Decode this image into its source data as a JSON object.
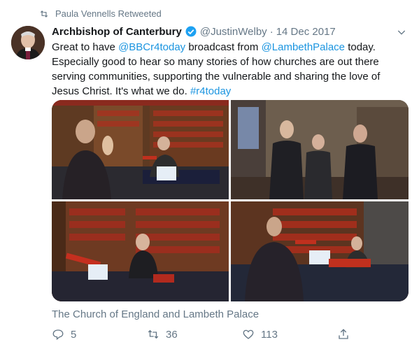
{
  "retweet": {
    "label": "Paula Vennells Retweeted",
    "icon": "retweet-icon"
  },
  "author": {
    "name": "Archbishop of Canterbury",
    "handle": "@JustinWelby",
    "separator": "·",
    "date": "14 Dec 2017",
    "verified_icon": "verified-badge-icon"
  },
  "tweet": {
    "part1": "Great to have ",
    "mention1": "@BBCr4today",
    "part2": " broadcast from ",
    "mention2": "@LambethPalace",
    "part3": " today. Especially good to hear so many stories of how churches are out there serving communities, supporting the vulnerable and sharing the love of Jesus Christ. It's what we do. ",
    "hashtag": "#r4today"
  },
  "media": {
    "photos": [
      {
        "name": "photo-presenter-in-library"
      },
      {
        "name": "photo-standing-group"
      },
      {
        "name": "photo-woman-at-microphone"
      },
      {
        "name": "photo-interview-at-table"
      }
    ]
  },
  "location": "The Church of England and Lambeth Palace",
  "actions": {
    "reply_count": "5",
    "retweet_count": "36",
    "like_count": "113"
  },
  "colors": {
    "link": "#1b95e0",
    "secondary_text": "#657786",
    "verified": "#1da1f2"
  }
}
